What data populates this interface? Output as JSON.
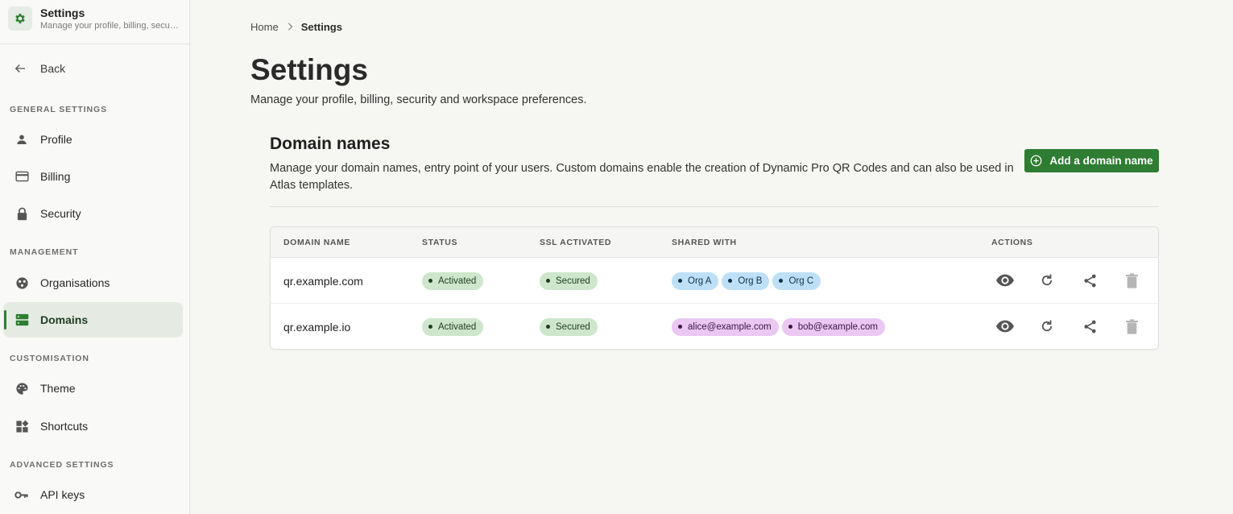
{
  "app": {
    "title": "Settings",
    "subtitle": "Manage your profile, billing, security and workspace preferences."
  },
  "sidebar": {
    "back_label": "Back",
    "sections": [
      {
        "label": "GENERAL SETTINGS",
        "items": [
          {
            "label": "Profile",
            "icon": "person-icon"
          },
          {
            "label": "Billing",
            "icon": "credit-card-icon"
          },
          {
            "label": "Security",
            "icon": "lock-icon"
          }
        ]
      },
      {
        "label": "MANAGEMENT",
        "items": [
          {
            "label": "Organisations",
            "icon": "organisations-icon"
          },
          {
            "label": "Domains",
            "icon": "domains-icon",
            "active": true
          }
        ]
      },
      {
        "label": "CUSTOMISATION",
        "items": [
          {
            "label": "Theme",
            "icon": "palette-icon"
          },
          {
            "label": "Shortcuts",
            "icon": "shortcuts-icon"
          }
        ]
      },
      {
        "label": "ADVANCED SETTINGS",
        "items": [
          {
            "label": "API keys",
            "icon": "key-icon"
          }
        ]
      }
    ]
  },
  "breadcrumb": {
    "home": "Home",
    "current": "Settings"
  },
  "page": {
    "title": "Settings",
    "subtitle": "Manage your profile, billing, security and workspace preferences."
  },
  "domains": {
    "title": "Domain names",
    "description": "Manage your domain names, entry point of your users. Custom domains enable the creation of Dynamic Pro QR Codes and can also be used in Atlas templates.",
    "add_label": "Add a domain name",
    "columns": [
      "DOMAIN NAME",
      "STATUS",
      "SSL ACTIVATED",
      "SHARED WITH",
      "ACTIONS"
    ],
    "rows": [
      {
        "domain": "qr.example.com",
        "status": "Activated",
        "ssl": "Secured",
        "shared": [
          {
            "label": "Org A",
            "kind": "org"
          },
          {
            "label": "Org B",
            "kind": "org"
          },
          {
            "label": "Org C",
            "kind": "org"
          }
        ]
      },
      {
        "domain": "qr.example.io",
        "status": "Activated",
        "ssl": "Secured",
        "shared": [
          {
            "label": "alice@example.com",
            "kind": "user"
          },
          {
            "label": "bob@example.com",
            "kind": "user"
          }
        ]
      }
    ],
    "actions": [
      "view-icon",
      "refresh-icon",
      "share-icon",
      "delete-icon"
    ]
  },
  "colors": {
    "accent": "#2e7d32",
    "badge_green": "#cde6cc",
    "badge_blue": "#bde0f6",
    "badge_purple": "#eac8f2"
  }
}
